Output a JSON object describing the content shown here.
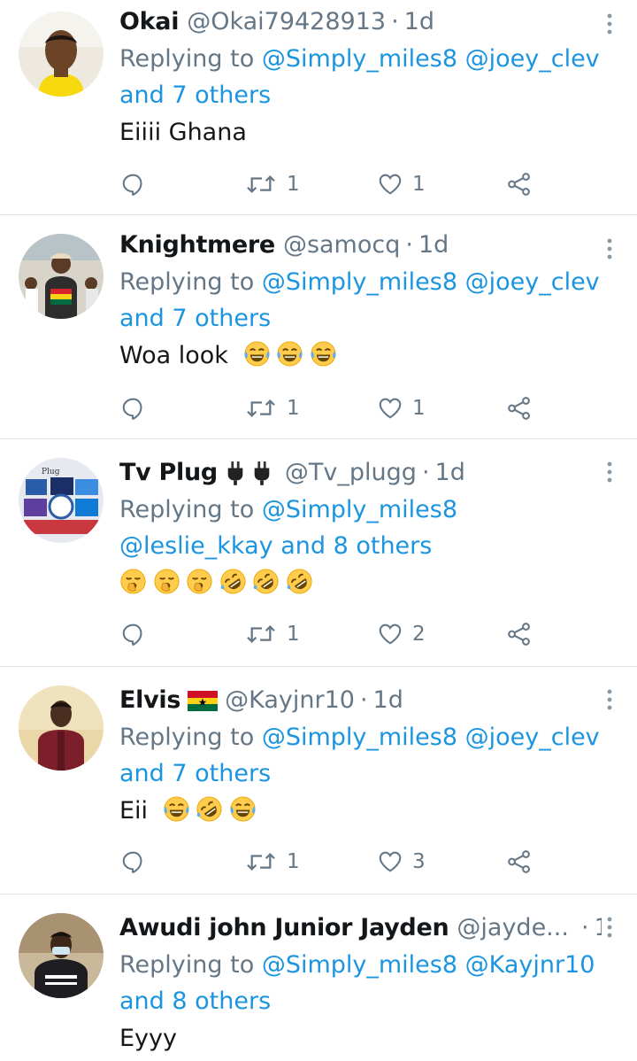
{
  "tweets": [
    {
      "name": "Okai",
      "handle": "@Okai79428913",
      "time": "1d",
      "reply_prefix": "Replying to",
      "reply_line1": "@Simply_miles8 @joey_clev",
      "reply_line2": "and 7 others",
      "text": "Eiiii Ghana",
      "replies": "",
      "retweets": "1",
      "likes": "1"
    },
    {
      "name": "Knightmere",
      "handle": "@samocq",
      "time": "1d",
      "reply_prefix": "Replying to",
      "reply_line1": "@Simply_miles8 @joey_clev",
      "reply_line2": "and 7 others",
      "text": "Woa look",
      "retweets": "1",
      "likes": "1"
    },
    {
      "name": "Tv Plug",
      "handle": "@Tv_plugg",
      "time": "1d",
      "reply_prefix": "Replying to",
      "reply_line1": "@Simply_miles8",
      "reply_line2": "@leslie_kkay and 8 others",
      "text": "",
      "retweets": "1",
      "likes": "2"
    },
    {
      "name": "Elvis",
      "handle": "@Kayjnr10",
      "time": "1d",
      "reply_prefix": "Replying to",
      "reply_line1": "@Simply_miles8 @joey_clev",
      "reply_line2": "and 7 others",
      "text": "Eii",
      "retweets": "1",
      "likes": "3"
    },
    {
      "name": "Awudi john Junior Jayden",
      "handle": "@jayde...",
      "time": "1d",
      "reply_prefix": "Replying to",
      "reply_line1": "@Simply_miles8 @Kayjnr10",
      "reply_line2": "and 8 others",
      "text": "Eyyy"
    }
  ],
  "separator": "·",
  "icons": {
    "reply": "reply-icon",
    "retweet": "retweet-icon",
    "like": "heart-icon",
    "share": "share-icon",
    "more": "more-vertical-icon",
    "plug": "plug-emoji",
    "laugh": "tears-of-joy-emoji",
    "rofl": "rolling-laughing-emoji",
    "yawn": "yawning-emoji",
    "flag": "ghana-flag-emoji"
  },
  "colors": {
    "link": "#1b95e0",
    "muted": "#657786",
    "text": "#14171a",
    "divider": "#dfe3e6"
  }
}
